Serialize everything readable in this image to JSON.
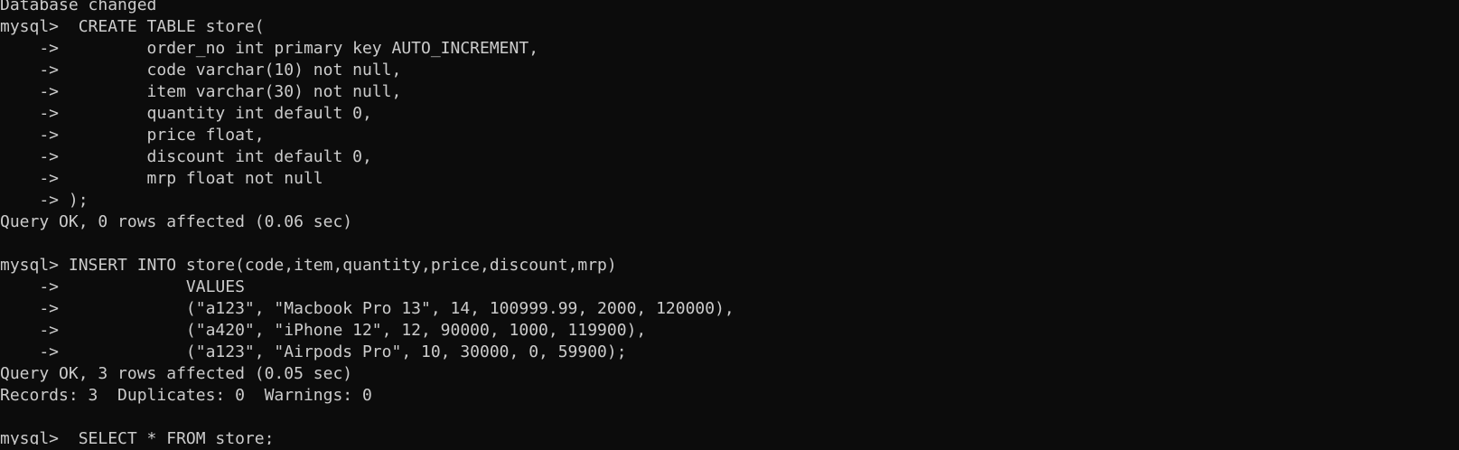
{
  "terminal": {
    "lines": [
      "Database changed",
      "mysql>  CREATE TABLE store(",
      "    ->         order_no int primary key AUTO_INCREMENT,",
      "    ->         code varchar(10) not null,",
      "    ->         item varchar(30) not null,",
      "    ->         quantity int default 0,",
      "    ->         price float,",
      "    ->         discount int default 0,",
      "    ->         mrp float not null",
      "    -> );",
      "Query OK, 0 rows affected (0.06 sec)",
      "",
      "mysql> INSERT INTO store(code,item,quantity,price,discount,mrp)",
      "    ->             VALUES",
      "    ->             (\"a123\", \"Macbook Pro 13\", 14, 100999.99, 2000, 120000),",
      "    ->             (\"a420\", \"iPhone 12\", 12, 90000, 1000, 119900),",
      "    ->             (\"a123\", \"Airpods Pro\", 10, 30000, 0, 59900);",
      "Query OK, 3 rows affected (0.05 sec)",
      "Records: 3  Duplicates: 0  Warnings: 0",
      "",
      "mysql>  SELECT * FROM store;"
    ]
  },
  "colors": {
    "background": "#0c0c0c",
    "foreground": "#cccccc"
  }
}
